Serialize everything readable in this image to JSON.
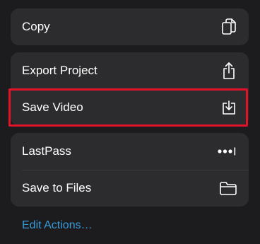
{
  "menu": {
    "groups": [
      {
        "items": [
          {
            "label": "Copy",
            "icon": "copy-icon"
          }
        ]
      },
      {
        "items": [
          {
            "label": "Export Project",
            "icon": "share-icon"
          },
          {
            "label": "Save Video",
            "icon": "download-icon",
            "highlighted": true
          }
        ]
      },
      {
        "items": [
          {
            "label": "LastPass",
            "icon": "more-dots-icon"
          },
          {
            "label": "Save to Files",
            "icon": "folder-icon"
          }
        ]
      }
    ],
    "edit_actions_label": "Edit Actions…"
  },
  "colors": {
    "background": "#1c1c1e",
    "group_background": "#2c2c2e",
    "text": "#ffffff",
    "link": "#3a9bd9",
    "highlight_border": "#e0132a"
  }
}
